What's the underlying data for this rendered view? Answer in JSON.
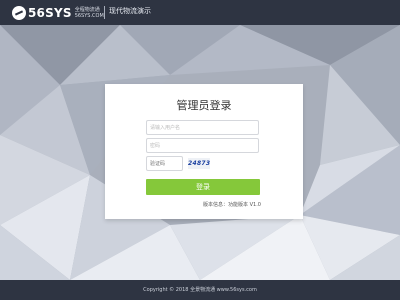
{
  "header": {
    "logo_text": "56SYS",
    "logo_sub_top": "全程物流通",
    "logo_sub_bottom": "56SYS.COM",
    "system_name": "现代物流演示"
  },
  "login": {
    "title": "管理员登录",
    "username_placeholder": "请输入用户名",
    "password_placeholder": "密码",
    "captcha_placeholder": "验证码",
    "captcha_text": "24873",
    "submit_label": "登录",
    "version_label": "版本信息：",
    "version_value": "功能版本 V1.0"
  },
  "footer": {
    "copyright": "Copyright © 2018 全景物流通 www.56sys.com"
  },
  "colors": {
    "topbar": "#2e3442",
    "accent_green": "#85c83a",
    "background": "#aab0bd"
  }
}
